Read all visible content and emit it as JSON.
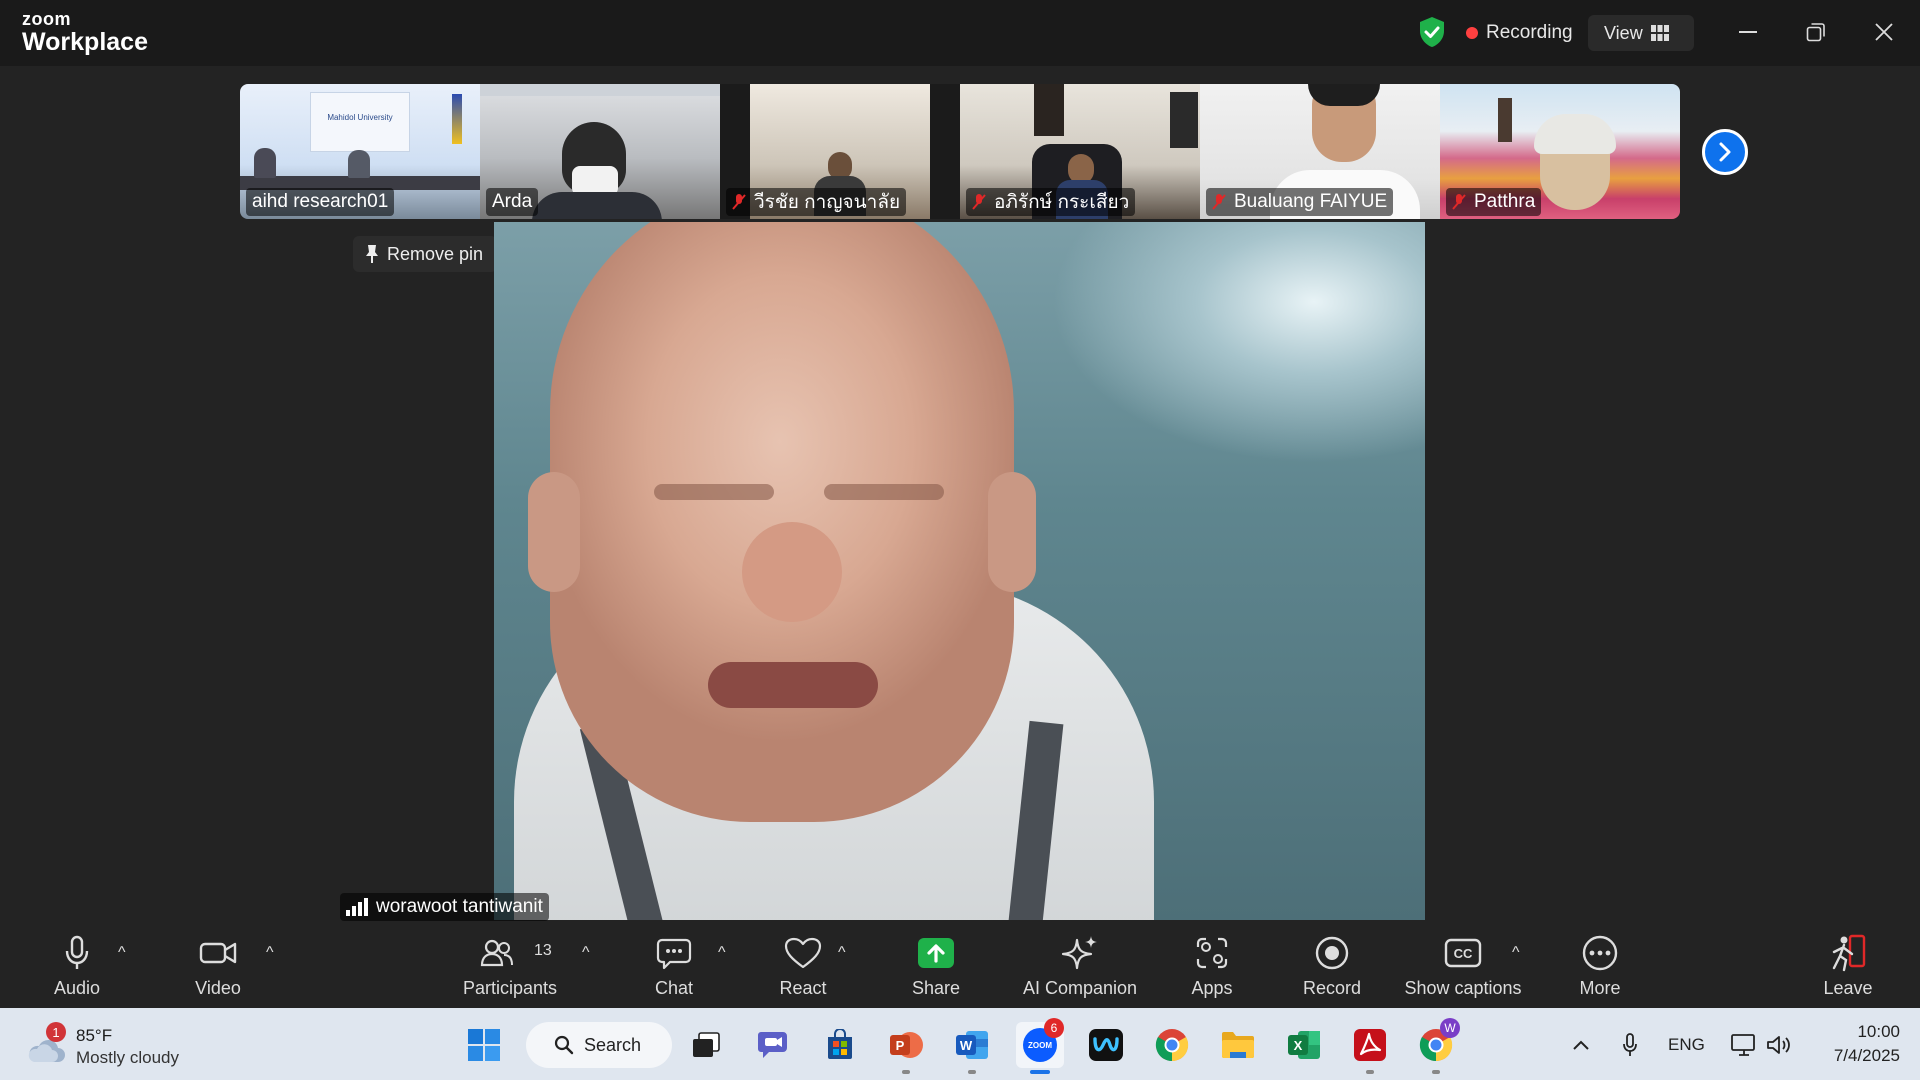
{
  "titlebar": {
    "brand_top": "zoom",
    "brand_bottom": "Workplace",
    "recording_label": "Recording",
    "view_label": "View",
    "colors": {
      "recording_dot": "#ff4040",
      "shield": "#1fb14a"
    }
  },
  "strip": {
    "tiles": [
      {
        "name": "aihd research01",
        "muted": false
      },
      {
        "name": "Arda",
        "muted": false
      },
      {
        "name": "วีรชัย กาญจนาลัย",
        "muted": true
      },
      {
        "name": "อภิรักษ์ กระเสียว",
        "muted": true
      },
      {
        "name": "Bualuang FAIYUE",
        "muted": true
      },
      {
        "name": "Patthra",
        "muted": true
      }
    ],
    "next_icon": "chevron-right-icon",
    "banner_text": "Mahidol University"
  },
  "main": {
    "pin_label": "Remove pin",
    "speaker_name": "worawoot tantiwanit"
  },
  "toolbar": {
    "audio": "Audio",
    "video": "Video",
    "participants": "Participants",
    "participants_count": "13",
    "chat": "Chat",
    "react": "React",
    "share": "Share",
    "ai_companion": "AI Companion",
    "apps": "Apps",
    "record": "Record",
    "show_captions": "Show captions",
    "more": "More",
    "leave": "Leave",
    "colors": {
      "share": "#1fb14a",
      "leave": "#e02828"
    }
  },
  "taskbar": {
    "weather_badge": "1",
    "temperature": "85°F",
    "weather_desc": "Mostly cloudy",
    "search_label": "Search",
    "zoom_badge": "6",
    "chrome_badge": "W",
    "zoom_logo_text": "ZOOM",
    "language": "ENG",
    "time": "10:00",
    "date": "7/4/2025"
  }
}
